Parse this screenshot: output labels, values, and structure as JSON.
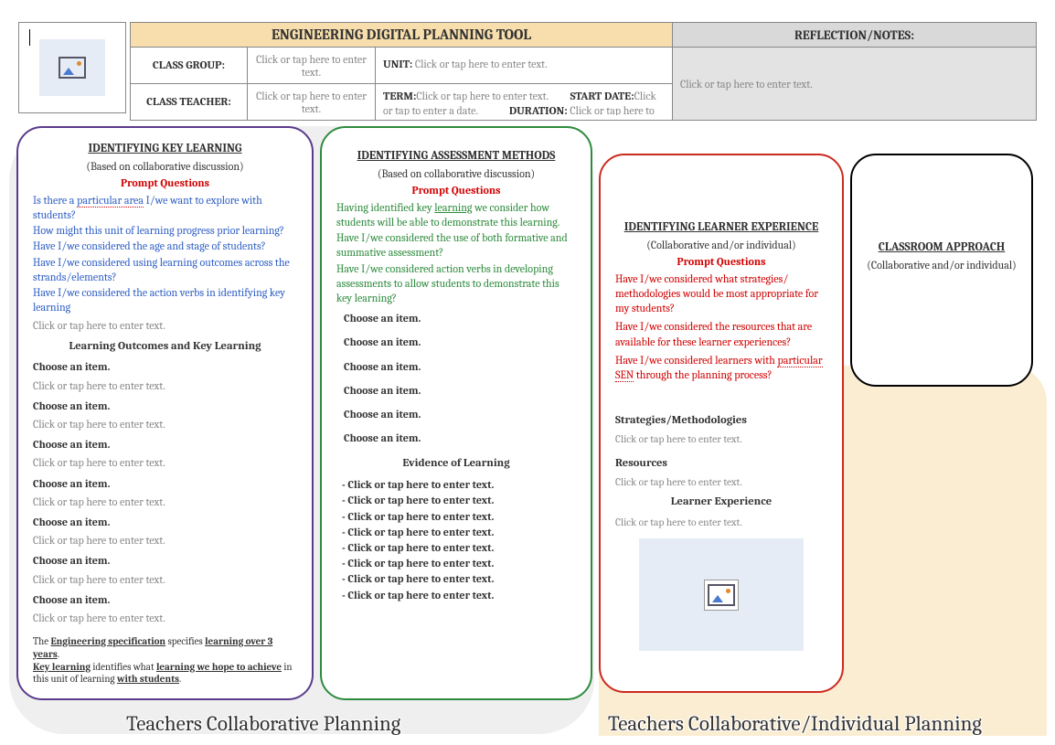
{
  "header": {
    "title": "ENGINEERING DIGITAL PLANNING TOOL",
    "reflection_title": "REFLECTION/NOTES:",
    "reflection_placeholder": "Click or tap here to enter text.",
    "class_group_label": "CLASS GROUP:",
    "class_group_placeholder": "Click or tap here to enter text.",
    "class_teacher_label": "CLASS TEACHER:",
    "class_teacher_placeholder": "Click or tap here to enter text.",
    "unit_label": "UNIT:",
    "unit_placeholder": "Click or tap here to enter text.",
    "term_label": "TERM:",
    "term_placeholder": "Click or tap here to enter text.",
    "start_date_label": "START DATE:",
    "start_date_placeholder": "Click or tap to enter a date.",
    "duration_label": "DURATION:",
    "duration_placeholder": "Click or tap here to enter text."
  },
  "panel1": {
    "title": "IDENTIFYING KEY LEARNING",
    "sub": "(Based on collaborative discussion)",
    "prompt": "Prompt Questions",
    "q1a": "Is there a ",
    "q1b": "particular area",
    "q1c": " I/we want to explore with students?",
    "q2": "How might this unit of learning progress prior learning?",
    "q3": "Have I/we considered the age and stage of students?",
    "q4": "Have I/we considered using learning outcomes across the strands/elements?",
    "q5": "Have I/we considered the action verbs in identifying key learning",
    "placeholder": "Click or tap here to enter text.",
    "section": "Learning Outcomes and Key Learning",
    "choose": "Choose an item.",
    "foot1a": "The ",
    "foot1b": "Engineering specification",
    "foot1c": " specifies ",
    "foot1d": "learning over 3 years",
    "foot1e": ".",
    "foot2a": "Key learning",
    "foot2b": " identifies what ",
    "foot2c": "learning we hope to achieve",
    "foot2d": " in this unit of learning ",
    "foot2e": "with students",
    "foot2f": "."
  },
  "panel2": {
    "title": "IDENTIFYING ASSESSMENT METHODS",
    "sub": "(Based on collaborative discussion)",
    "prompt": "Prompt Questions",
    "q1a": "Having identified key ",
    "q1b": "learning",
    "q1c": " we consider how students will be able to demonstrate this learning.",
    "q2": "Have I/we considered the use of both formative and summative assessment?",
    "q3": "Have I/we considered action verbs in developing assessments to allow students to demonstrate this key learning?",
    "choose": "Choose an item.",
    "section": "Evidence of Learning",
    "ev": "- Click or tap here to enter text."
  },
  "panel3": {
    "title": "IDENTIFYING LEARNER EXPERIENCE",
    "sub": "(Collaborative and/or individual)",
    "prompt": "Prompt Questions",
    "q1": "Have I/we considered what strategies/ methodologies would be most appropriate for my students?",
    "q2": "Have I/we considered the resources that are available for these learner experiences?",
    "q3a": "Have I/we considered learners with ",
    "q3b": "particular SEN",
    "q3c": " through the planning process?",
    "h1": "Strategies/Methodologies",
    "h2": "Resources",
    "h3": "Learner Experience",
    "placeholder": "Click or tap here to enter text."
  },
  "panel4": {
    "title": "CLASSROOM APPROACH",
    "sub": "(Collaborative and/or individual)"
  },
  "footer": {
    "left": "Teachers Collaborative Planning",
    "right": "Teachers Collaborative/Individual Planning"
  }
}
